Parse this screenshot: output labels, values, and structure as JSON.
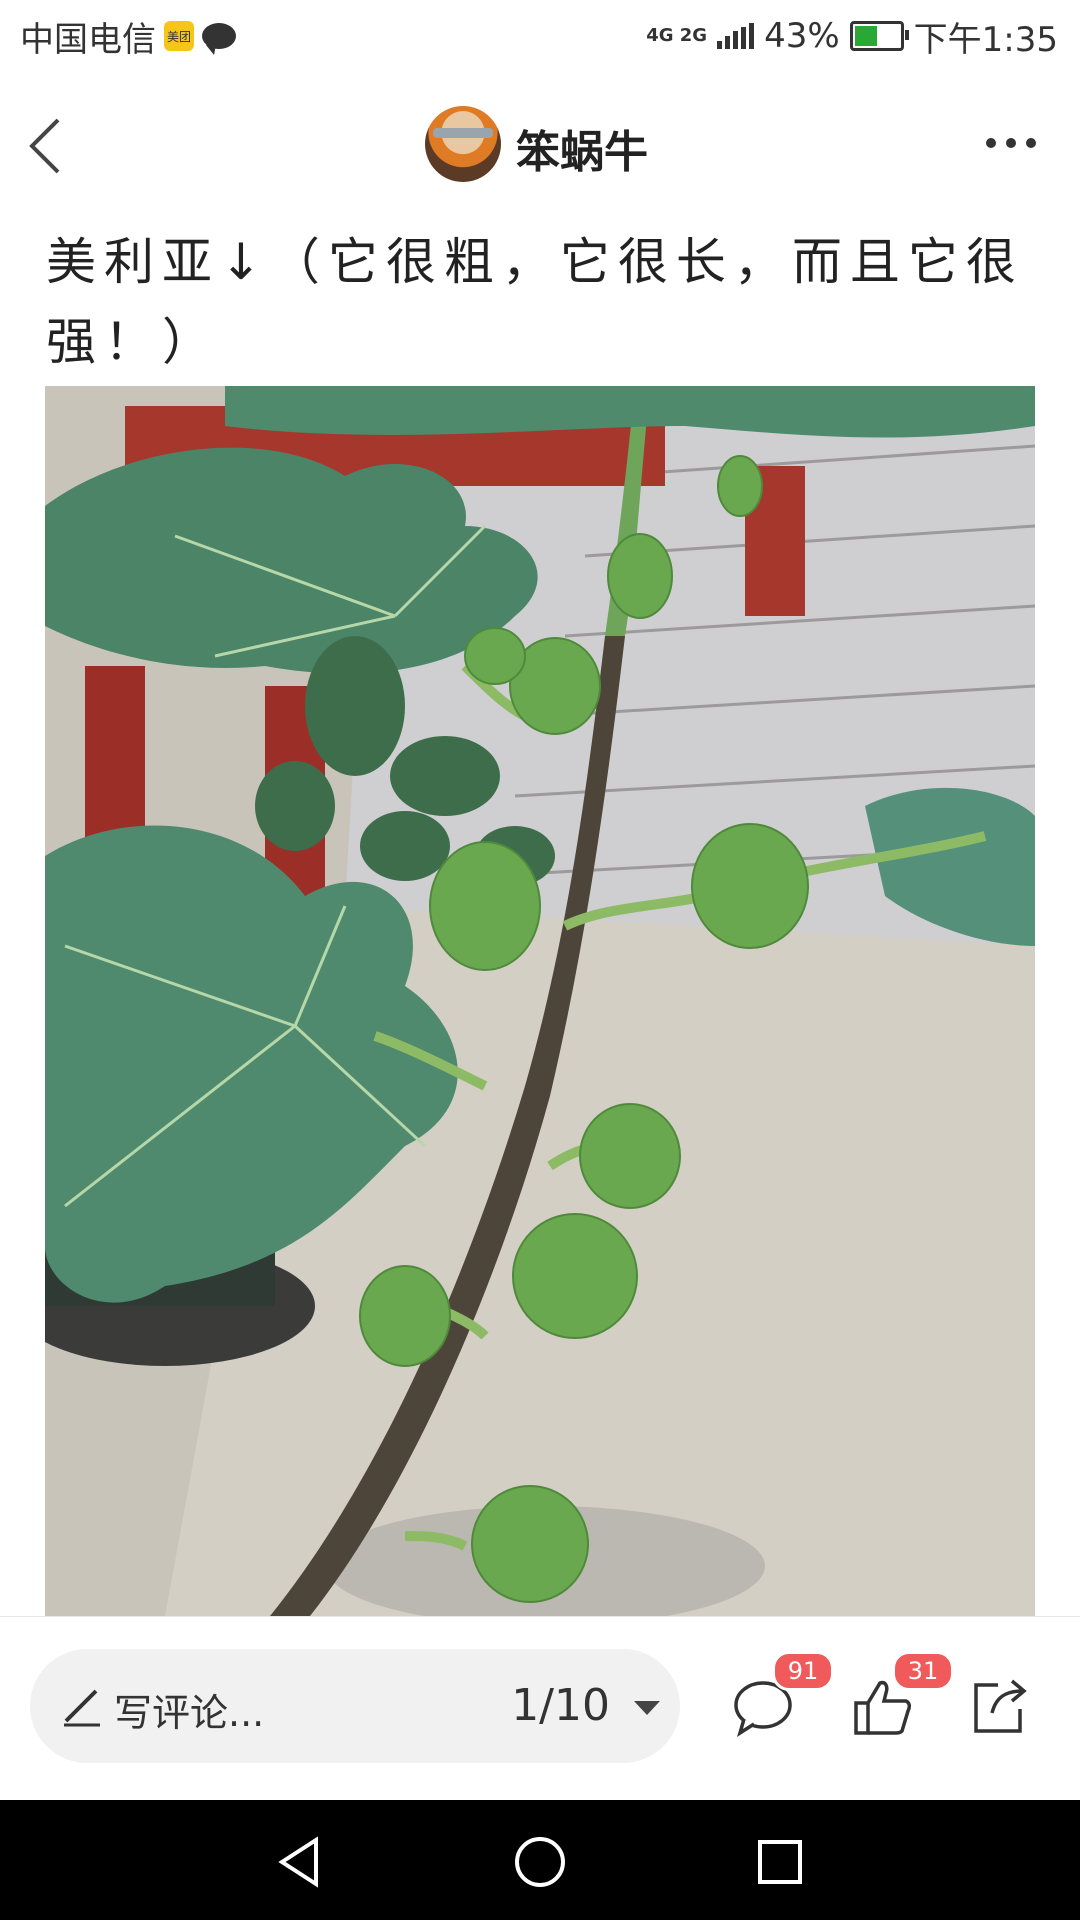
{
  "status_bar": {
    "carrier": "中国电信",
    "meituan_label": "美团",
    "network": "4G 2G",
    "battery": "43%",
    "time": "下午1:35"
  },
  "header": {
    "username": "笨蜗牛",
    "avatar_icon": "naruto-avatar"
  },
  "post": {
    "title": "美利亚↓（它很粗，它很长，而且它很强！）"
  },
  "bottom_bar": {
    "comment_placeholder": "写评论...",
    "page_counter": "1/10",
    "comment_count": "91",
    "like_count": "31",
    "icons": [
      "comment-icon",
      "like-icon",
      "share-icon"
    ]
  },
  "colors": {
    "badge": "#f05a5a",
    "battery_fill": "#2aa836"
  }
}
